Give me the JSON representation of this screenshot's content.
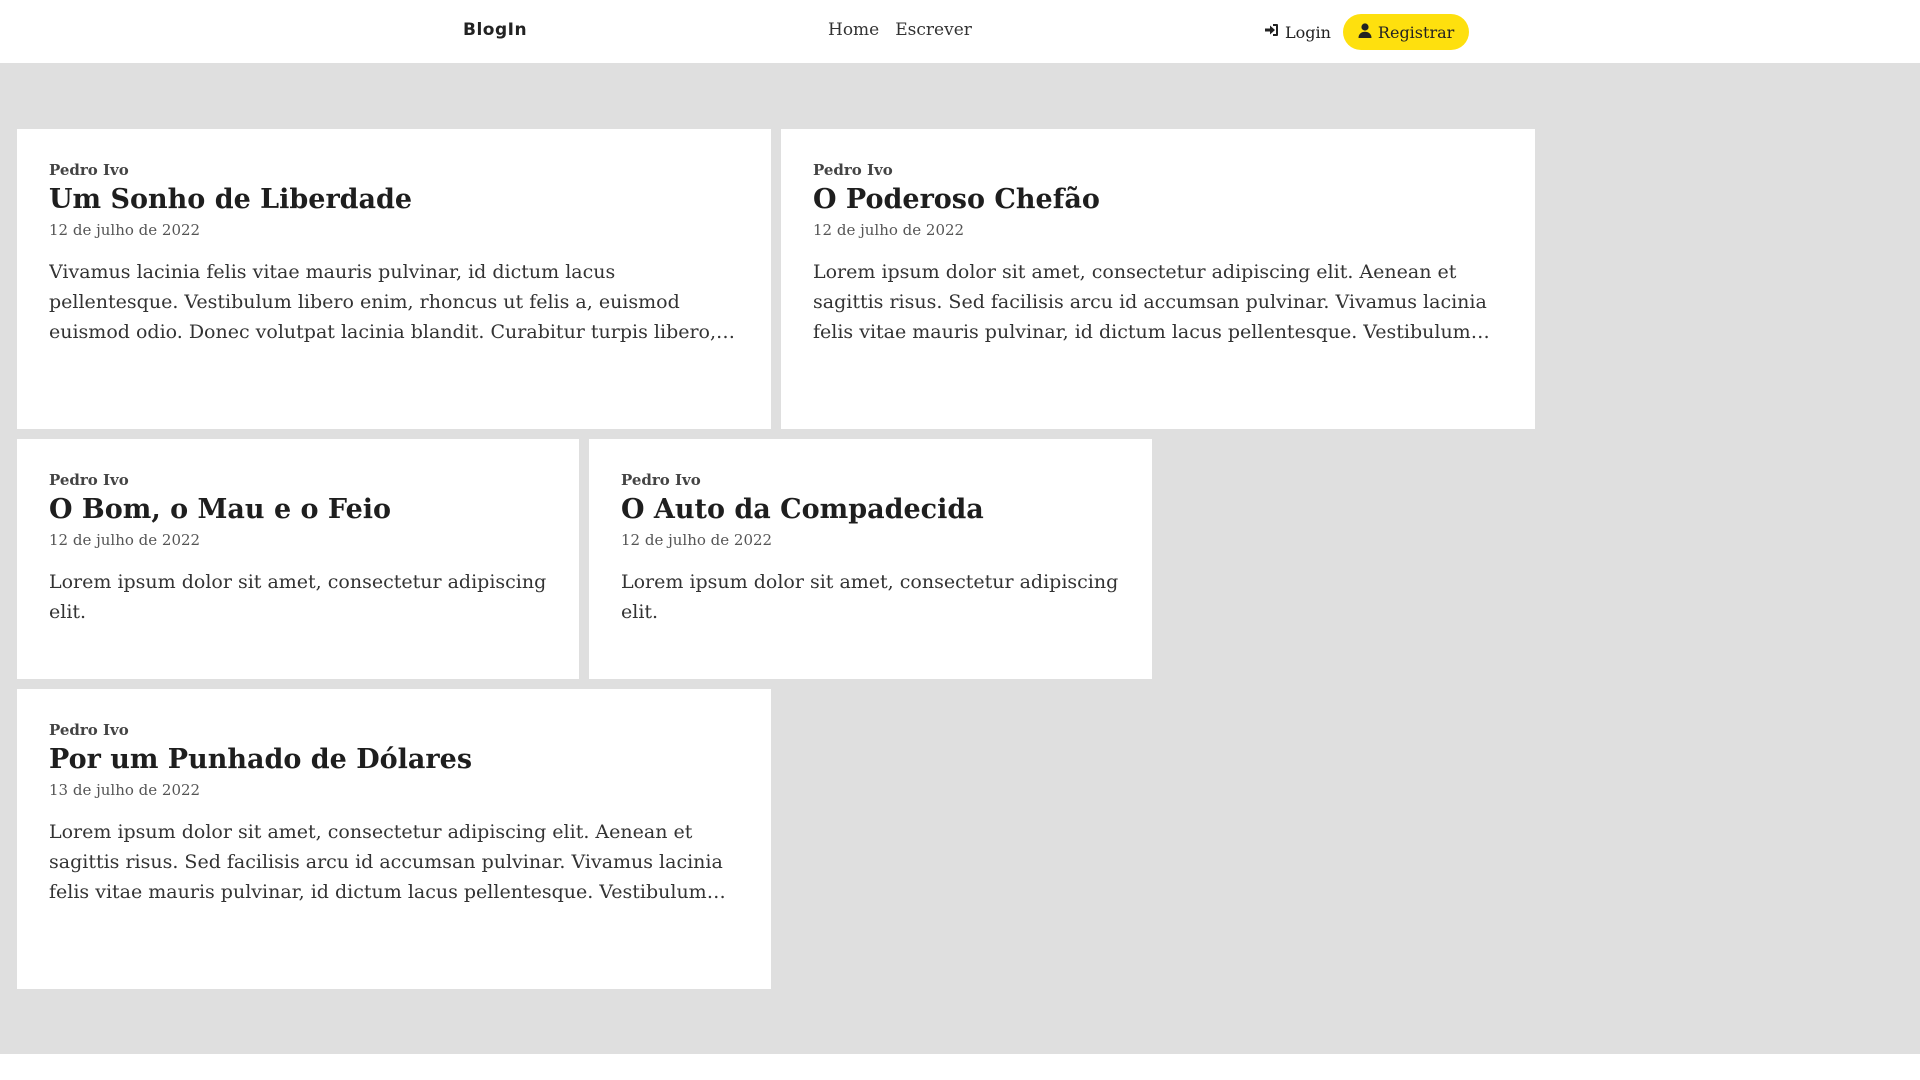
{
  "navbar": {
    "brand": "BlogIn",
    "links": [
      "Home",
      "Escrever"
    ],
    "login_label": "Login",
    "register_label": "Registrar",
    "accent_color": "#fee00e"
  },
  "posts": [
    {
      "author": "Pedro Ivo",
      "title": "Um Sonho de Liberdade",
      "date": "12 de julho de 2022",
      "excerpt": "Vivamus lacinia felis vitae mauris pulvinar, id dictum lacus pellentesque. Vestibulum libero enim, rhoncus ut felis a, euismod euismod odio. Donec volutpat lacinia blandit. Curabitur turpis libero, scelerisque at leo vehicula,..."
    },
    {
      "author": "Pedro Ivo",
      "title": "O Poderoso Chefão",
      "date": "12 de julho de 2022",
      "excerpt": "Lorem ipsum dolor sit amet, consectetur adipiscing elit. Aenean et sagittis risus. Sed facilisis arcu id accumsan pulvinar. Vivamus lacinia felis vitae mauris pulvinar, id dictum lacus pellentesque. Vestibulum libero enim,..."
    },
    {
      "author": "Pedro Ivo",
      "title": "O Bom, o Mau e o Feio",
      "date": "12 de julho de 2022",
      "excerpt": "Lorem ipsum dolor sit amet, consectetur adipiscing elit."
    },
    {
      "author": "Pedro Ivo",
      "title": "O Auto da Compadecida",
      "date": "12 de julho de 2022",
      "excerpt": "Lorem ipsum dolor sit amet, consectetur adipiscing elit."
    },
    {
      "author": "Pedro Ivo",
      "title": "Por um Punhado de Dólares",
      "date": "13 de julho de 2022",
      "excerpt": "Lorem ipsum dolor sit amet, consectetur adipiscing elit. Aenean et sagittis risus. Sed facilisis arcu id accumsan pulvinar. Vivamus lacinia felis vitae mauris pulvinar, id dictum lacus pellentesque. Vestibulum libero enim,..."
    }
  ]
}
